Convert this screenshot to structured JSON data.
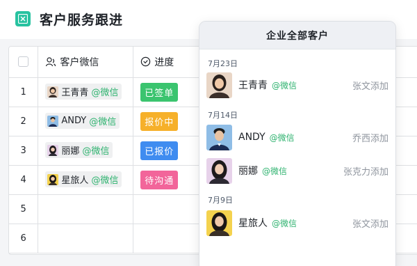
{
  "header": {
    "title": "客户服务跟进",
    "icon": "table-app-icon",
    "icon_color": "#27c2a0"
  },
  "table": {
    "columns": [
      {
        "label": "",
        "icon": "checkbox"
      },
      {
        "label": "客户微信",
        "icon": "contacts-icon"
      },
      {
        "label": "进度",
        "icon": "circle-check-icon"
      }
    ],
    "rows": [
      {
        "index": "1",
        "name": "王青青",
        "suffix": "@微信",
        "status": "已签单",
        "status_color": "#3bc46f",
        "avatar_bg": "#e9d6c6"
      },
      {
        "index": "2",
        "name": "ANDY",
        "suffix": "@微信",
        "status": "报价中",
        "status_color": "#f6b02a",
        "avatar_bg": "#8fbde6"
      },
      {
        "index": "3",
        "name": "丽娜",
        "suffix": "@微信",
        "status": "已报价",
        "status_color": "#3f8cf0",
        "avatar_bg": "#e7d2ea"
      },
      {
        "index": "4",
        "name": "星旅人",
        "suffix": "@微信",
        "status": "待沟通",
        "status_color": "#f2659a",
        "avatar_bg": "#f4d24e"
      },
      {
        "index": "5",
        "name": "",
        "suffix": "",
        "status": "",
        "status_color": "",
        "avatar_bg": ""
      },
      {
        "index": "6",
        "name": "",
        "suffix": "",
        "status": "",
        "status_color": "",
        "avatar_bg": ""
      }
    ]
  },
  "popup": {
    "title": "企业全部客户",
    "groups": [
      {
        "date": "7月23日",
        "contacts": [
          {
            "name": "王青青",
            "suffix": "@微信",
            "added_by": "张文添加",
            "avatar_bg": "#e9d6c6"
          }
        ]
      },
      {
        "date": "7月14日",
        "contacts": [
          {
            "name": "ANDY",
            "suffix": "@微信",
            "added_by": "乔西添加",
            "avatar_bg": "#8fbde6"
          },
          {
            "name": "丽娜",
            "suffix": "@微信",
            "added_by": "张克力添加",
            "avatar_bg": "#e7d2ea"
          }
        ]
      },
      {
        "date": "7月9日",
        "contacts": [
          {
            "name": "星旅人",
            "suffix": "@微信",
            "added_by": "张文添加",
            "avatar_bg": "#f4d24e"
          }
        ]
      }
    ]
  }
}
